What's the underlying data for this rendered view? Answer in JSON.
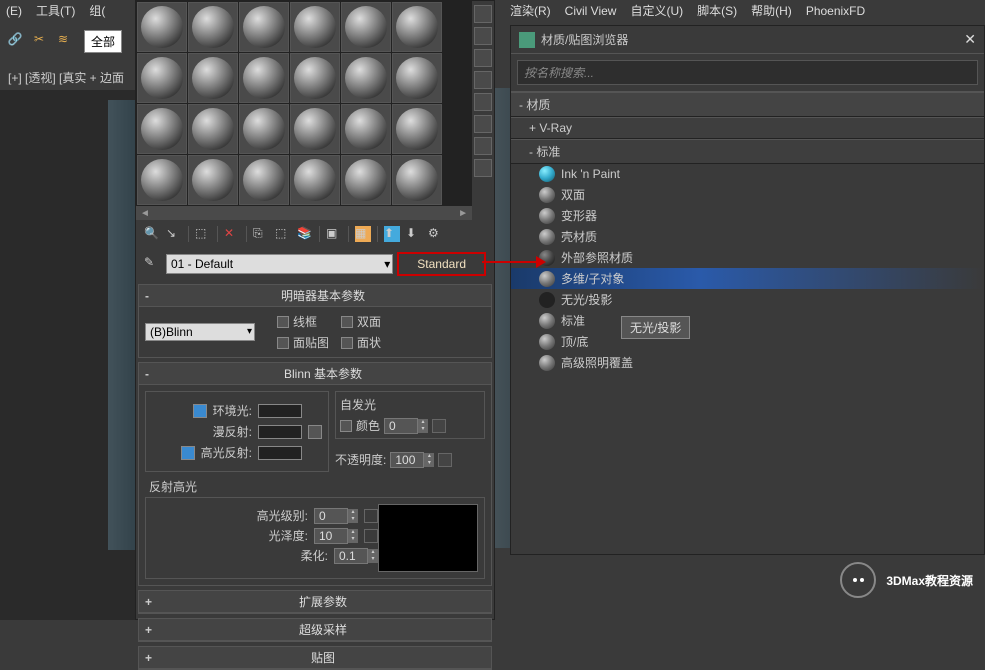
{
  "menus": {
    "left": [
      "(E)",
      "工具(T)",
      "组("
    ],
    "right": [
      "渲染(R)",
      "Civil View",
      "自定义(U)",
      "脚本(S)",
      "帮助(H)",
      "PhoenixFD"
    ]
  },
  "toolbar": {
    "all_button": "全部"
  },
  "viewport": {
    "label": "[+] [透视] [真实 + 边面"
  },
  "material_editor": {
    "name_select": "01 - Default",
    "type_button": "Standard",
    "rollups": {
      "shader_params": "明暗器基本参数",
      "blinn_params": "Blinn 基本参数",
      "extended": "扩展参数",
      "supersample": "超级采样",
      "maps": "贴图"
    },
    "shader": {
      "type": "(B)Blinn",
      "wireframe": "线框",
      "two_sided": "双面",
      "face_map": "面贴图",
      "faceted": "面状"
    },
    "blinn": {
      "ambient": "环境光:",
      "diffuse": "漫反射:",
      "specular": "高光反射:",
      "self_illum_title": "自发光",
      "color_label": "颜色",
      "color_val": "0",
      "opacity_label": "不透明度:",
      "opacity_val": "100",
      "specular_highlights": "反射高光",
      "spec_level": "高光级别:",
      "spec_level_val": "0",
      "glossiness": "光泽度:",
      "glossiness_val": "10",
      "soften": "柔化:",
      "soften_val": "0.1"
    }
  },
  "browser": {
    "title": "材质/贴图浏览器",
    "search_placeholder": "按名称搜索...",
    "sections": {
      "materials": "- 材质",
      "vray": "+ V-Ray",
      "standard": "- 标准"
    },
    "items": [
      "Ink 'n Paint",
      "双面",
      "变形器",
      "壳材质",
      "外部参照材质",
      "多维/子对象",
      "无光/投影",
      "标准",
      "顶/底",
      "高级照明覆盖"
    ],
    "tooltip": "无光/投影"
  },
  "watermark": "3DMax教程资源"
}
